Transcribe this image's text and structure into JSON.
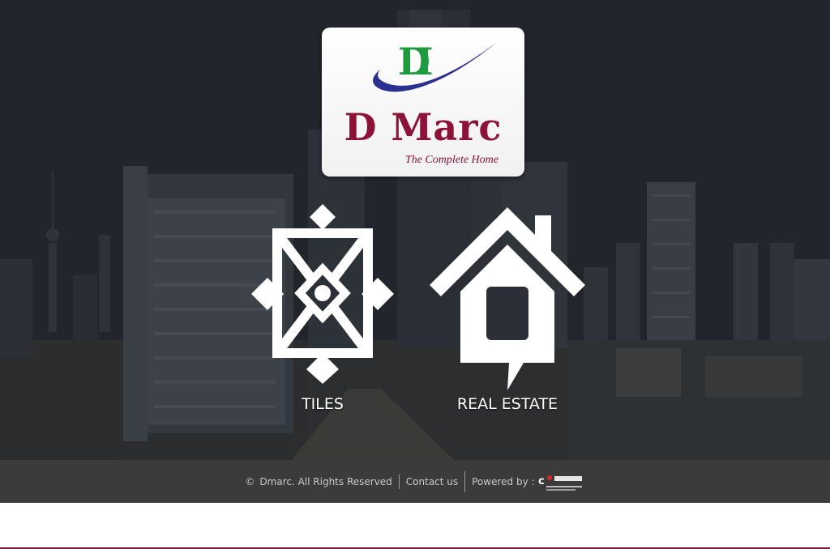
{
  "brand": {
    "name": "D Marc",
    "tagline": "The Complete Home",
    "mark_text": "DM"
  },
  "categories": [
    {
      "label": "TILES",
      "icon": "tiles-pattern-icon"
    },
    {
      "label": "REAL ESTATE",
      "icon": "house-icon"
    }
  ],
  "footer": {
    "copyright_symbol": "©",
    "copyright_text": "Dmarc. All Rights Reserved",
    "contact_label": "Contact us",
    "powered_by_label": "Powered by :",
    "powered_by_logo": "coimbatore-web-logo"
  },
  "colors": {
    "brand_red": "#8c1238",
    "logo_green": "#1e9b3c",
    "logo_blue": "#2b2f8f",
    "footer_bg": "#3b3b3b"
  }
}
